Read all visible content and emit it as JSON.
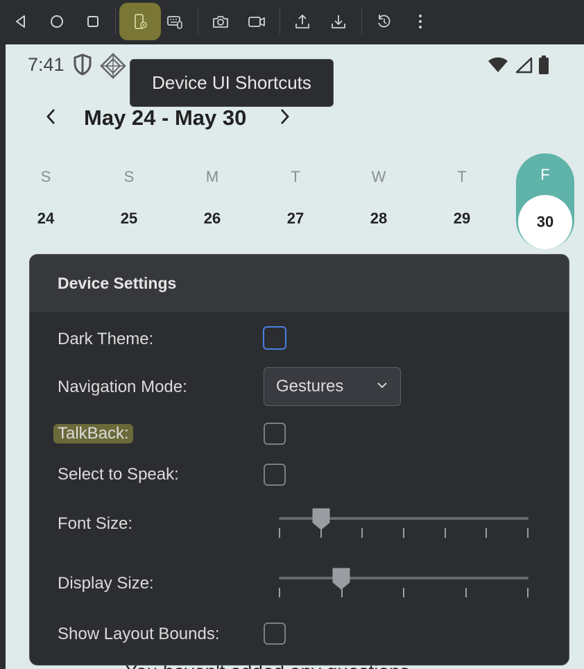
{
  "toolbar": {
    "buttons": [
      {
        "name": "back-icon"
      },
      {
        "name": "home-icon"
      },
      {
        "name": "overview-icon"
      },
      {
        "name": "device-ui-shortcuts-icon",
        "active": true
      },
      {
        "name": "keyboard-mouse-icon"
      },
      {
        "name": "camera-icon"
      },
      {
        "name": "video-record-icon"
      },
      {
        "name": "upload-icon"
      },
      {
        "name": "download-icon"
      },
      {
        "name": "snapshot-restore-icon"
      },
      {
        "name": "more-vert-icon"
      }
    ],
    "active_color": "#7a7635"
  },
  "tooltip": {
    "text": "Device UI Shortcuts"
  },
  "status_bar": {
    "time": "7:41"
  },
  "calendar": {
    "range": "May 24 - May 30",
    "days": [
      {
        "letter": "S",
        "num": "24"
      },
      {
        "letter": "S",
        "num": "25"
      },
      {
        "letter": "M",
        "num": "26"
      },
      {
        "letter": "T",
        "num": "27"
      },
      {
        "letter": "W",
        "num": "28"
      },
      {
        "letter": "T",
        "num": "29"
      },
      {
        "letter": "F",
        "num": "30",
        "selected": true
      }
    ],
    "accent": "#5fb3a9"
  },
  "settings": {
    "title": "Device Settings",
    "dark_theme_label": "Dark Theme:",
    "navigation_label": "Navigation Mode:",
    "navigation_value": "Gestures",
    "talkback_label": "TalkBack:",
    "select_to_speak_label": "Select to Speak:",
    "font_size_label": "Font Size:",
    "font_size_level": 0.17,
    "display_size_label": "Display Size:",
    "display_size_level": 0.25,
    "show_layout_bounds_label": "Show Layout Bounds:"
  },
  "bottom_text": "You haven't added any questions"
}
